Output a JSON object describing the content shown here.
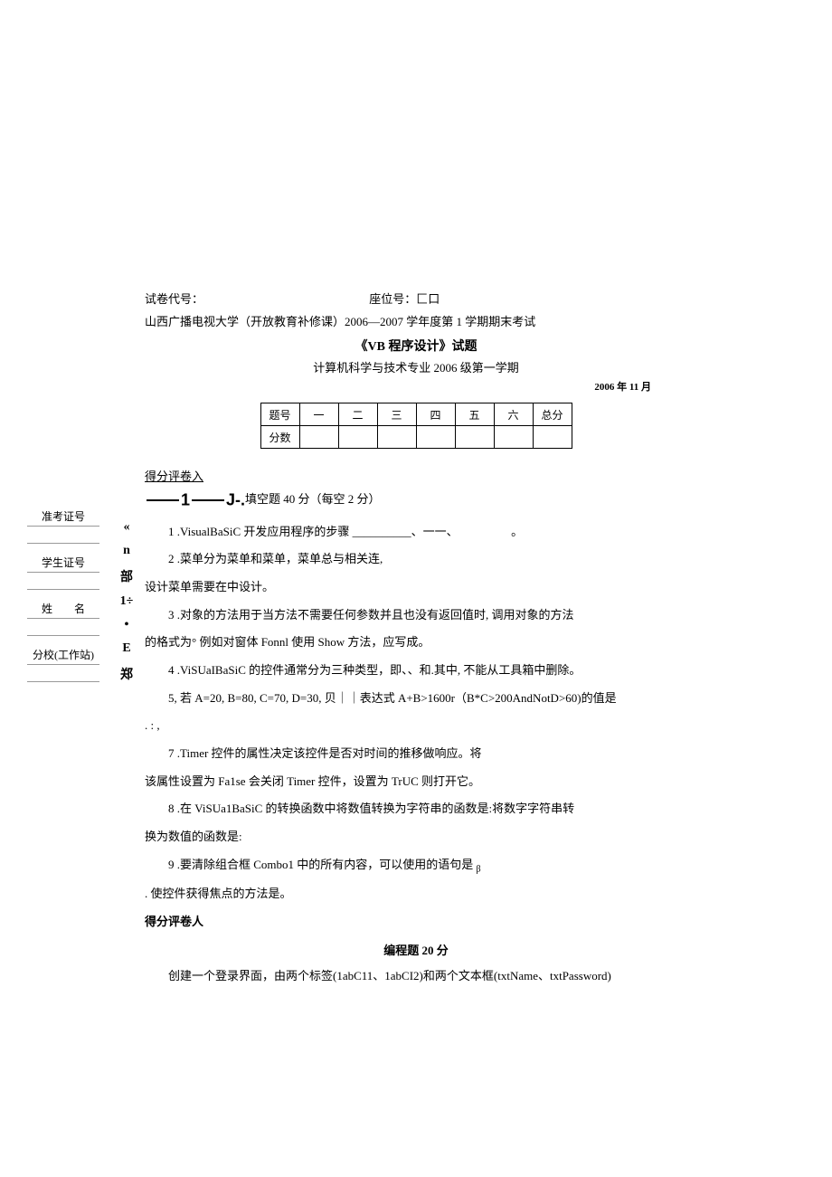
{
  "header": {
    "exam_code_label": "试卷代号：",
    "seat_label": "座位号：匚口",
    "university_line": "山西广播电视大学（开放教育补修课）2006—2007 学年度第 1 学期期末考试",
    "course_title": "《VB 程序设计》试题",
    "subtitle": "计算机科学与技术专业 2006 级第一学期",
    "date": "2006 年 11 月"
  },
  "score_table": {
    "row1": [
      "题号",
      "一",
      "二",
      "三",
      "四",
      "五",
      "六",
      "总分"
    ],
    "row2_label": "分数"
  },
  "marker": "得分评卷入",
  "section1_label": "填空题 40 分（每空 2 分）",
  "sidebar": {
    "field1": "准考证号",
    "field2": "学生证号",
    "field3": "姓　　名",
    "field4": "分校(工作站)"
  },
  "vchars": [
    "«",
    "n",
    "部",
    "1÷",
    "•",
    "E",
    "郑"
  ],
  "questions": {
    "q1": "1   .VisualBaSiC 开发应用程序的步骤 __________、一一、　　　　　。",
    "q2": "2   .菜单分为菜单和菜单，菜单总与相关连,",
    "q2b": "设计菜单需要在中设计。",
    "q3": "3   .对象的方法用于当方法不需要任何参数并且也没有返回值时, 调用对象的方法",
    "q3b": "的格式为° 例如对窗体 Fonnl 使用 Show 方法，应写成。",
    "q4": "4   .ViSUaIBaSiC 的控件通常分为三种类型，即、、和.其中, 不能从工具箱中删除。",
    "q5": "5, 若 A=20, B=80, C=70, D=30, 贝｜｜表达式 A+B>1600r（B*C>200AndNotD>60)的值是",
    "q5b": ". : ,",
    "q7": "7   .Timer 控件的属性决定该控件是否对时间的推移做响应。将",
    "q7b": "该属性设置为 Fa1se 会关闭 Timer 控件，设置为 TrUC 则打开它。",
    "q8": "8   .在 ViSUa1BaSiC 的转换函数中将数值转换为字符串的函数是:将数字字符串转",
    "q8b": "换为数值的函数是:",
    "q9": "9   .要清除组合框 Combo1 中的所有内容，可以使用的语句是",
    "q9tail": "β",
    "q10": ". 使控件获得焦点的方法是。",
    "marker2": "得分评卷人",
    "section2_title": "编程题 20 分",
    "prog_intro": "创建一个登录界面，由两个标签(1abC11、1abCI2)和两个文本框(txtName、txtPassword)"
  }
}
